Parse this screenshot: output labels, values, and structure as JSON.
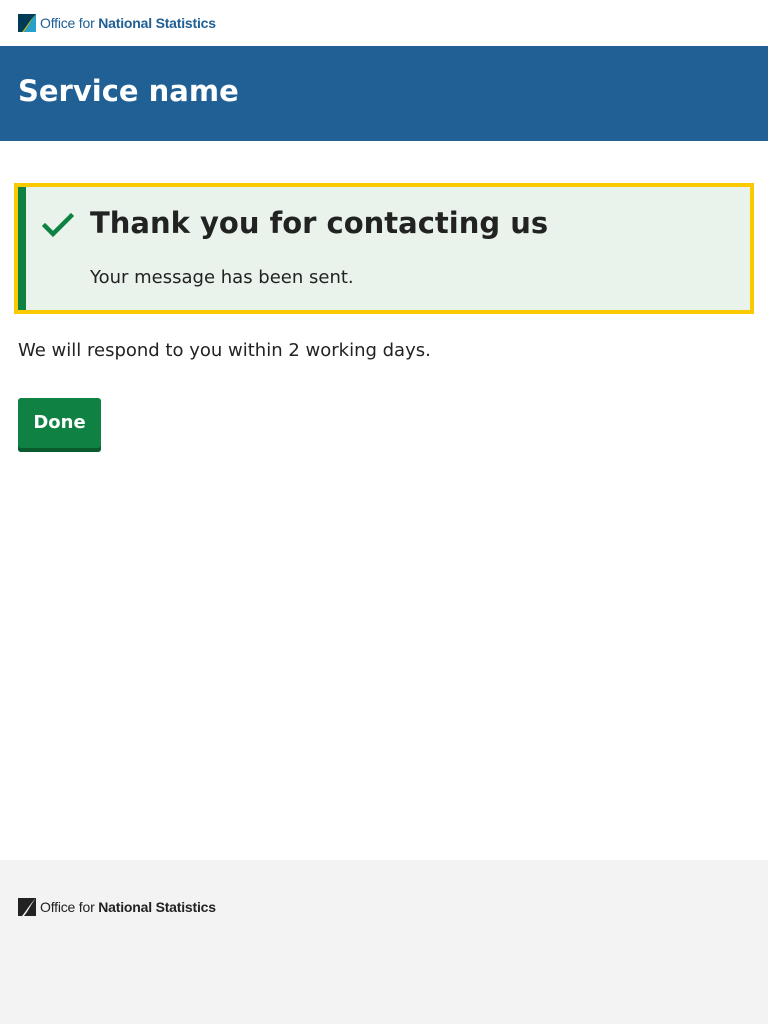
{
  "header": {
    "logo": {
      "part1": "Office for",
      "part2": "National Statistics",
      "icon": "ons-logo-icon"
    },
    "service_name": "Service name"
  },
  "panel": {
    "icon": "check-icon",
    "title": "Thank you for contacting us",
    "body": "Your message has been sent."
  },
  "main": {
    "message": "We will respond to you within 2 working days.",
    "done_button": "Done"
  },
  "footer": {
    "logo": {
      "part1": "Office for",
      "part2": "National Statistics",
      "icon": "ons-logo-icon"
    }
  },
  "colors": {
    "brand_blue": "#206095",
    "success_green": "#0f8243",
    "panel_bg": "#e9f3ec",
    "focus_yellow": "#fbc900",
    "footer_bg": "#f3f3f3"
  }
}
